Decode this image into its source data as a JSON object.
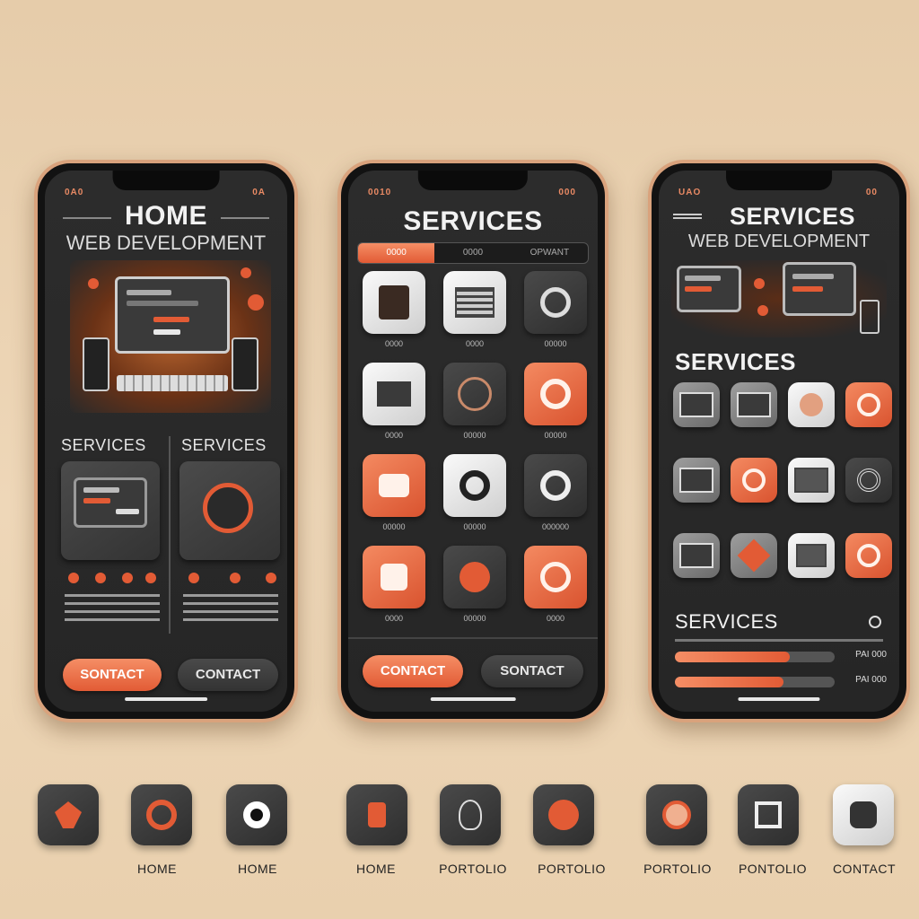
{
  "colors": {
    "accent": "#e25b35",
    "background": "#e8cfae",
    "screen": "#2a2a2a"
  },
  "phone1": {
    "status_left": "0A0",
    "status_right": "0A",
    "title": "HOME",
    "subtitle": "WEB DEVELOPMENT",
    "services_left": "SERVICES",
    "services_right": "SERVICES",
    "primary_button": "SONTACT",
    "secondary_button": "CONTACT"
  },
  "phone2": {
    "status_left": "0010",
    "status_right": "000",
    "title": "SERVICES",
    "tabs": [
      "0000",
      "0000",
      "OPWANT"
    ],
    "icon_labels": [
      "0000",
      "0000",
      "00000",
      "0000",
      "00000",
      "00000",
      "00000",
      "00000",
      "000000",
      "0000",
      "00000",
      "0000"
    ],
    "primary_button": "CONTACT",
    "secondary_button": "SONTACT"
  },
  "phone3": {
    "status_left": "UAO",
    "status_right": "00",
    "title": "SERVICES",
    "subtitle": "WEB DEVELOPMENT",
    "services_heading": "SERVICES",
    "services_bottom": "SERVICES",
    "slider_1_label": "PAI 000",
    "slider_2_label": "PAI 000",
    "slider_1_value": 0.72,
    "slider_2_value": 0.68
  },
  "dock": {
    "items": [
      {
        "label": ""
      },
      {
        "label": "HOME"
      },
      {
        "label": "HOME"
      },
      {
        "label": "HOME"
      },
      {
        "label": "PORTOLIO"
      },
      {
        "label": "PORTOLIO"
      },
      {
        "label": "PORTOLIO"
      },
      {
        "label": "PONTOLIO"
      },
      {
        "label": "CONTACT"
      }
    ]
  }
}
